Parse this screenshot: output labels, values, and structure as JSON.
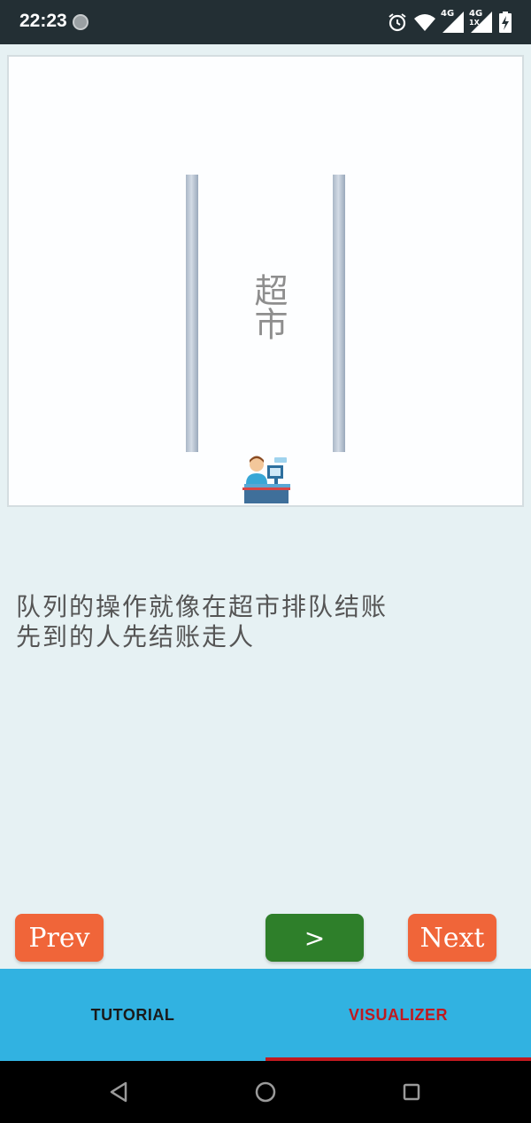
{
  "status_bar": {
    "time": "22:23",
    "network_1": "4G",
    "network_2": "4G",
    "network_2_sub": "1X",
    "icons": [
      "record-dot-icon",
      "alarm-icon",
      "wifi-icon",
      "cellular-signal-icon",
      "cellular-signal-icon",
      "battery-charging-icon"
    ]
  },
  "visualizer": {
    "store_sign": "超市",
    "icons": [
      "cashier-icon"
    ]
  },
  "description": {
    "line1": "队列的操作就像在超市排队结账",
    "line2": "先到的人先结账走人"
  },
  "controls": {
    "prev_label": "Prev",
    "play_label": ">",
    "next_label": "Next"
  },
  "tabs": [
    {
      "label": "TUTORIAL",
      "active": false
    },
    {
      "label": "VISUALIZER",
      "active": true
    }
  ],
  "colors": {
    "accent_orange": "#f06539",
    "play_green": "#2e7f2a",
    "tab_bar": "#31b2e1",
    "active_tab": "#c0191f"
  },
  "nav_bar": {
    "icons": [
      "back-icon",
      "home-icon",
      "recents-icon"
    ]
  }
}
